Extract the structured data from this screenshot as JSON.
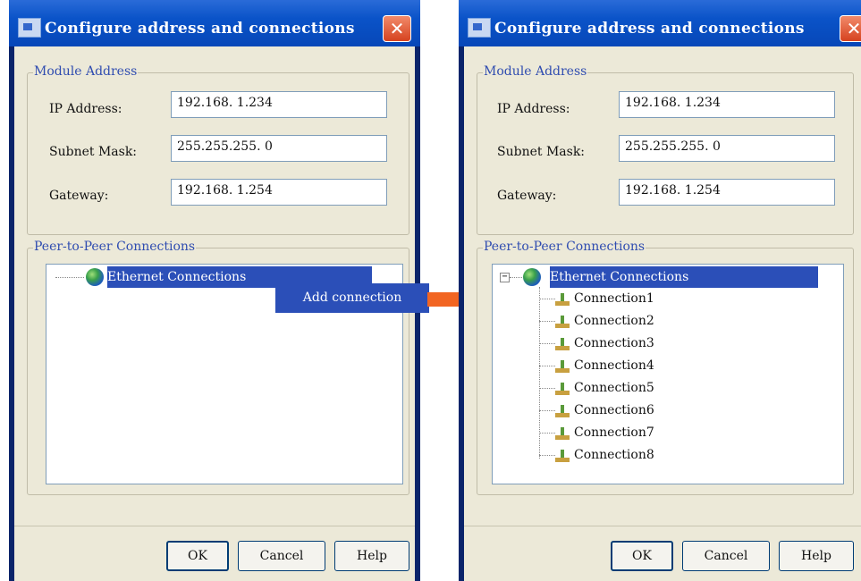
{
  "left_dialog": {
    "title": "Configure address and connections",
    "close_label": "✕",
    "module_address": {
      "group_label": "Module Address",
      "ip_label": "IP Address:",
      "ip_value": "192.168.  1.234",
      "subnet_label": "Subnet Mask:",
      "subnet_value": "255.255.255.  0",
      "gateway_label": "Gateway:",
      "gateway_value": "192.168.  1.254"
    },
    "peer": {
      "group_label": "Peer-to-Peer Connections",
      "root_label": "Ethernet Connections",
      "context_menu_item": "Add connection"
    },
    "buttons": {
      "ok": "OK",
      "cancel": "Cancel",
      "help": "Help"
    }
  },
  "right_dialog": {
    "title": "Configure address and connections",
    "close_label": "✕",
    "module_address": {
      "group_label": "Module Address",
      "ip_label": "IP Address:",
      "ip_value": "192.168.  1.234",
      "subnet_label": "Subnet Mask:",
      "subnet_value": "255.255.255.  0",
      "gateway_label": "Gateway:",
      "gateway_value": "192.168.  1.254"
    },
    "peer": {
      "group_label": "Peer-to-Peer Connections",
      "root_label": "Ethernet Connections",
      "expander": "−",
      "connections": [
        "Connection1",
        "Connection2",
        "Connection3",
        "Connection4",
        "Connection5",
        "Connection6",
        "Connection7",
        "Connection8"
      ]
    },
    "buttons": {
      "ok": "OK",
      "cancel": "Cancel",
      "help": "Help"
    }
  },
  "colors": {
    "arrow": "#f26522",
    "selection": "#2b4fb8",
    "titlebar": "#0a53c8"
  },
  "icons": {
    "title": "app-icon",
    "close": "close-icon",
    "root": "globe-icon",
    "connection": "network-node-icon",
    "arrow": "arrow-right-icon"
  }
}
